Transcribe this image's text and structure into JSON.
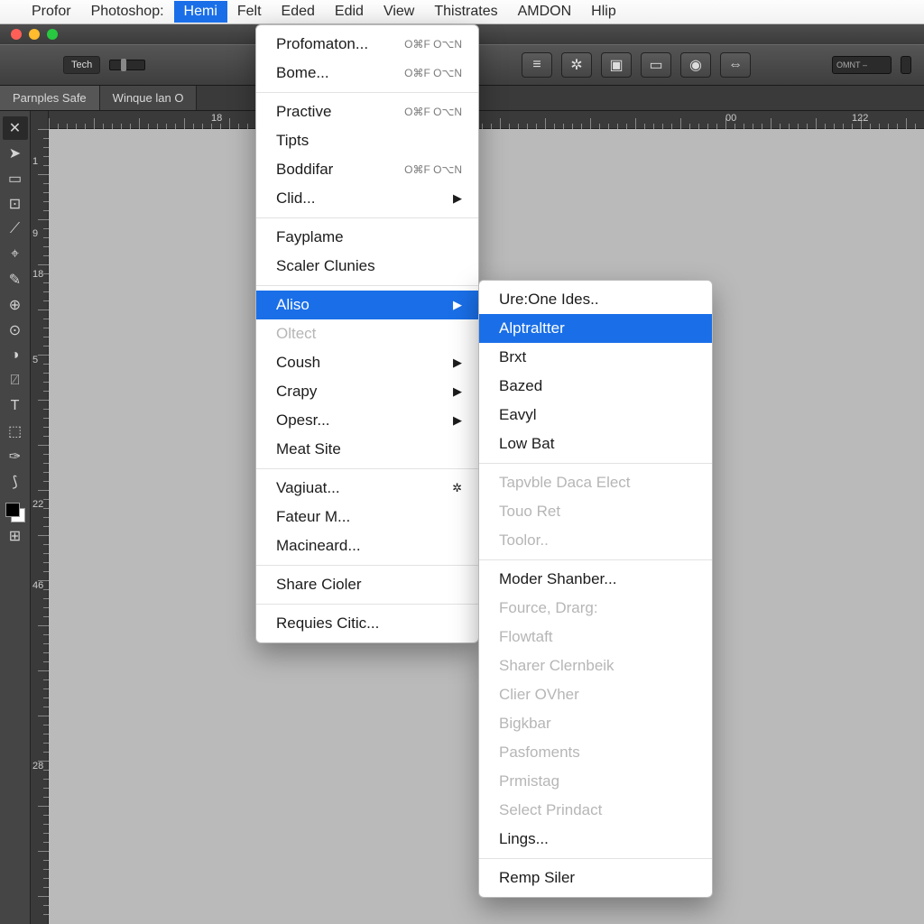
{
  "menubar": {
    "items": [
      "Profor",
      "Photoshop:",
      "Hemi",
      "Felt",
      "Eded",
      "Edid",
      "View",
      "Thistrates",
      "AMDON",
      "Hlip"
    ],
    "active_index": 2
  },
  "optionbar": {
    "label": "Tech",
    "right_small": "OMNT"
  },
  "tabs": [
    {
      "label": "Parnples Safe",
      "active": true
    },
    {
      "label": "Winque lan O",
      "active": false
    }
  ],
  "ruler_h": [
    {
      "text": "18",
      "pos": 180
    },
    {
      "text": "00",
      "pos": 750
    },
    {
      "text": "122",
      "pos": 890
    }
  ],
  "ruler_v": [
    {
      "text": "1",
      "pos": 50
    },
    {
      "text": "9",
      "pos": 130
    },
    {
      "text": "18",
      "pos": 175
    },
    {
      "text": "5",
      "pos": 270
    },
    {
      "text": "22",
      "pos": 430
    },
    {
      "text": "46",
      "pos": 520
    },
    {
      "text": "28",
      "pos": 720
    }
  ],
  "menu1": {
    "groups": [
      [
        {
          "label": "Profomaton...",
          "shortcut": "O⌘F\nO⌥N"
        },
        {
          "label": "Bome...",
          "shortcut": "O⌘F\nO⌥N"
        }
      ],
      [
        {
          "label": "Practive",
          "shortcut": "O⌘F\nO⌥N"
        },
        {
          "label": "Tipts"
        },
        {
          "label": "Boddifar",
          "shortcut": "O⌘F\nO⌥N"
        },
        {
          "label": "Clid...",
          "submenu": true
        }
      ],
      [
        {
          "label": "Fayplame"
        },
        {
          "label": "Scaler Clunies"
        }
      ],
      [
        {
          "label": "Aliso",
          "submenu": true,
          "highlight": true
        },
        {
          "label": "Oltect",
          "disabled": true
        },
        {
          "label": "Coush",
          "submenu": true
        },
        {
          "label": "Crapy",
          "submenu": true
        },
        {
          "label": "Opesr...",
          "submenu": true
        },
        {
          "label": "Meat Site"
        }
      ],
      [
        {
          "label": "Vagiuat...",
          "icon": "✲"
        },
        {
          "label": "Fateur M..."
        },
        {
          "label": "Macineard..."
        }
      ],
      [
        {
          "label": "Share Cioler"
        }
      ],
      [
        {
          "label": "Requies Citic..."
        }
      ]
    ]
  },
  "menu2": {
    "groups": [
      [
        {
          "label": "Ure:One Ides.."
        },
        {
          "label": "Alptraltter",
          "highlight": true
        },
        {
          "label": "Brxt"
        },
        {
          "label": "Bazed"
        },
        {
          "label": "Eavyl"
        },
        {
          "label": "Low Bat"
        }
      ],
      [
        {
          "label": "Tapvble Daca Elect",
          "disabled": true
        },
        {
          "label": "Touo Ret",
          "disabled": true
        },
        {
          "label": "Toolor..",
          "disabled": true
        }
      ],
      [
        {
          "label": "Moder Shanber..."
        },
        {
          "label": "Fource, Drarg:",
          "disabled": true
        },
        {
          "label": "Flowtaft",
          "disabled": true
        },
        {
          "label": "Sharer Clernbeik",
          "disabled": true
        },
        {
          "label": "Clier OVher",
          "disabled": true
        },
        {
          "label": "Bigkbar",
          "disabled": true
        },
        {
          "label": "Pasfoments",
          "disabled": true
        },
        {
          "label": "Prmistag",
          "disabled": true
        },
        {
          "label": "Select Prindact",
          "disabled": true
        },
        {
          "label": "Lings..."
        }
      ],
      [
        {
          "label": "Remp Siler"
        }
      ]
    ]
  },
  "tool_icons": [
    "✕",
    "➤",
    "▭",
    "⊡",
    "⟋",
    "⌖",
    "✎",
    "⊕",
    "⊙",
    "◑",
    "⍁",
    "T",
    "⬚",
    "✑",
    "⟆"
  ]
}
